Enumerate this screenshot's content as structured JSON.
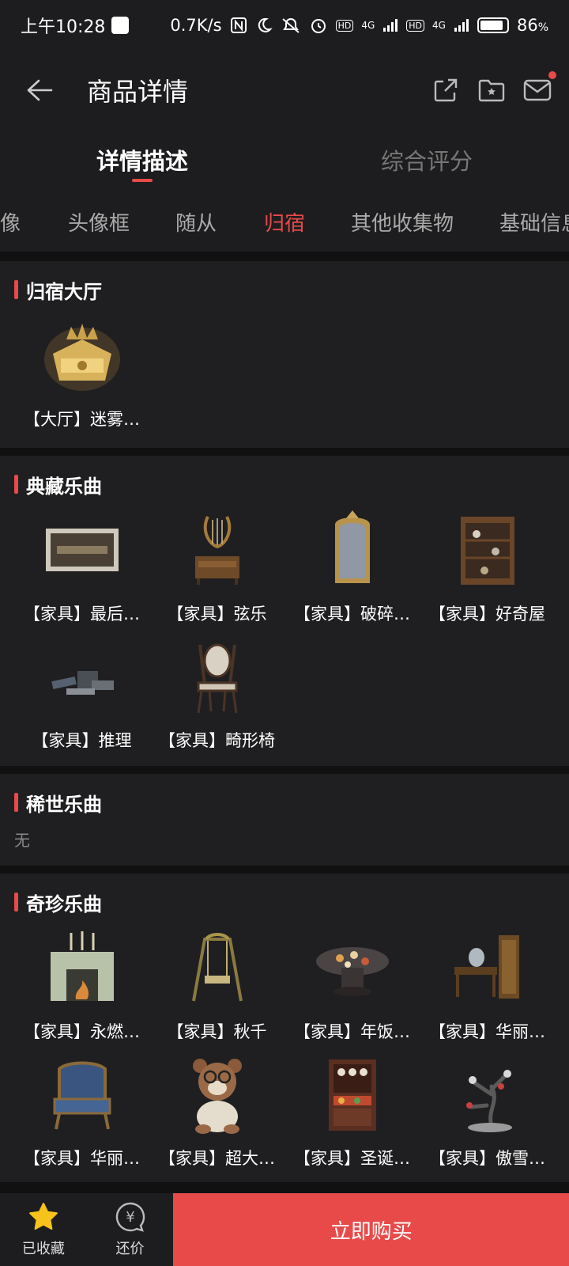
{
  "status_bar": {
    "time": "上午10:28",
    "net_speed": "0.7K/s",
    "net_label_1": "4G",
    "net_label_2": "4G",
    "hd_1": "HD",
    "hd_2": "HD",
    "battery_pct": "86",
    "battery_unit": "%",
    "battery_level": 0.86
  },
  "header": {
    "title": "商品详情"
  },
  "tabs": [
    {
      "label": "详情描述",
      "active": true
    },
    {
      "label": "综合评分",
      "active": false
    }
  ],
  "subtabs": [
    {
      "label": "像"
    },
    {
      "label": "头像框"
    },
    {
      "label": "随从"
    },
    {
      "label": "归宿",
      "active": true
    },
    {
      "label": "其他收集物"
    },
    {
      "label": "基础信息"
    }
  ],
  "sections": [
    {
      "title": "归宿大厅",
      "items": [
        {
          "label": "【大厅】迷雾…",
          "icon": "golden-hall-icon"
        }
      ]
    },
    {
      "title": "典藏乐曲",
      "items": [
        {
          "label": "【家具】最后…",
          "icon": "framed-painting-icon"
        },
        {
          "label": "【家具】弦乐",
          "icon": "lyre-cabinet-icon"
        },
        {
          "label": "【家具】破碎…",
          "icon": "mirror-icon"
        },
        {
          "label": "【家具】好奇屋",
          "icon": "curio-cabinet-icon"
        },
        {
          "label": "【家具】推理",
          "icon": "books-icon"
        },
        {
          "label": "【家具】畸形椅",
          "icon": "odd-chair-icon"
        }
      ]
    },
    {
      "title": "稀世乐曲",
      "empty_text": "无"
    },
    {
      "title": "奇珍乐曲",
      "items": [
        {
          "label": "【家具】永燃…",
          "icon": "fireplace-icon"
        },
        {
          "label": "【家具】秋千",
          "icon": "swing-icon"
        },
        {
          "label": "【家具】年饭…",
          "icon": "banquet-table-icon"
        },
        {
          "label": "【家具】华丽…",
          "icon": "vanity-set-icon"
        },
        {
          "label": "【家具】华丽…",
          "icon": "armchair-icon"
        },
        {
          "label": "【家具】超大…",
          "icon": "bear-plush-icon"
        },
        {
          "label": "【家具】圣诞…",
          "icon": "christmas-cabinet-icon"
        },
        {
          "label": "【家具】傲雪…",
          "icon": "plum-tree-icon"
        }
      ]
    }
  ],
  "bottom_bar": {
    "favorite_label": "已收藏",
    "bargain_label": "还价",
    "bargain_symbol": "¥",
    "buy_label": "立即购买"
  },
  "colors": {
    "accent": "#e84a4a",
    "background": "#111112",
    "panel": "#1f1f21"
  }
}
